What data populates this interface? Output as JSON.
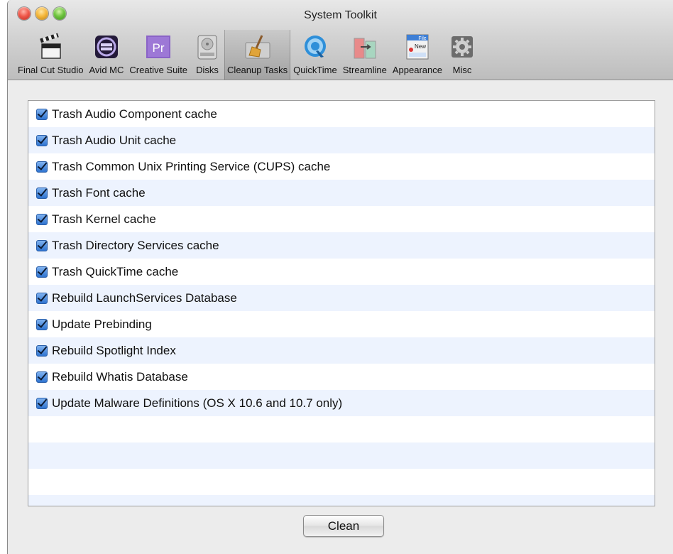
{
  "window": {
    "title": "System Toolkit"
  },
  "toolbar": {
    "items": [
      {
        "label": "Final Cut Studio",
        "icon": "clapperboard-icon"
      },
      {
        "label": "Avid MC",
        "icon": "avid-film-icon"
      },
      {
        "label": "Creative Suite",
        "icon": "premiere-icon"
      },
      {
        "label": "Disks",
        "icon": "disk-drive-icon"
      },
      {
        "label": "Cleanup Tasks",
        "icon": "broom-icon",
        "selected": true
      },
      {
        "label": "QuickTime",
        "icon": "quicktime-icon"
      },
      {
        "label": "Streamline",
        "icon": "streamline-icon"
      },
      {
        "label": "Appearance",
        "icon": "appearance-window-icon"
      },
      {
        "label": "Misc",
        "icon": "gear-icon"
      }
    ]
  },
  "tasks": [
    {
      "label": "Trash Audio Component cache",
      "checked": true
    },
    {
      "label": "Trash Audio Unit cache",
      "checked": true
    },
    {
      "label": "Trash Common Unix Printing Service (CUPS) cache",
      "checked": true
    },
    {
      "label": "Trash Font cache",
      "checked": true
    },
    {
      "label": "Trash Kernel cache",
      "checked": true
    },
    {
      "label": "Trash Directory Services cache",
      "checked": true
    },
    {
      "label": "Trash QuickTime cache",
      "checked": true
    },
    {
      "label": "Rebuild LaunchServices Database",
      "checked": true
    },
    {
      "label": "Update Prebinding",
      "checked": true
    },
    {
      "label": "Rebuild Spotlight Index",
      "checked": true
    },
    {
      "label": "Rebuild Whatis Database",
      "checked": true
    },
    {
      "label": "Update Malware Definitions (OS X 10.6 and 10.7 only)",
      "checked": true
    }
  ],
  "actions": {
    "clean_label": "Clean"
  },
  "icon_text": {
    "premiere": "Pr",
    "appearance_file": "File",
    "appearance_new": "New"
  },
  "colors": {
    "checkbox": "#2f74d0",
    "row_stripe": "#edf3fe",
    "selected_tool": "#c9c9c9"
  }
}
